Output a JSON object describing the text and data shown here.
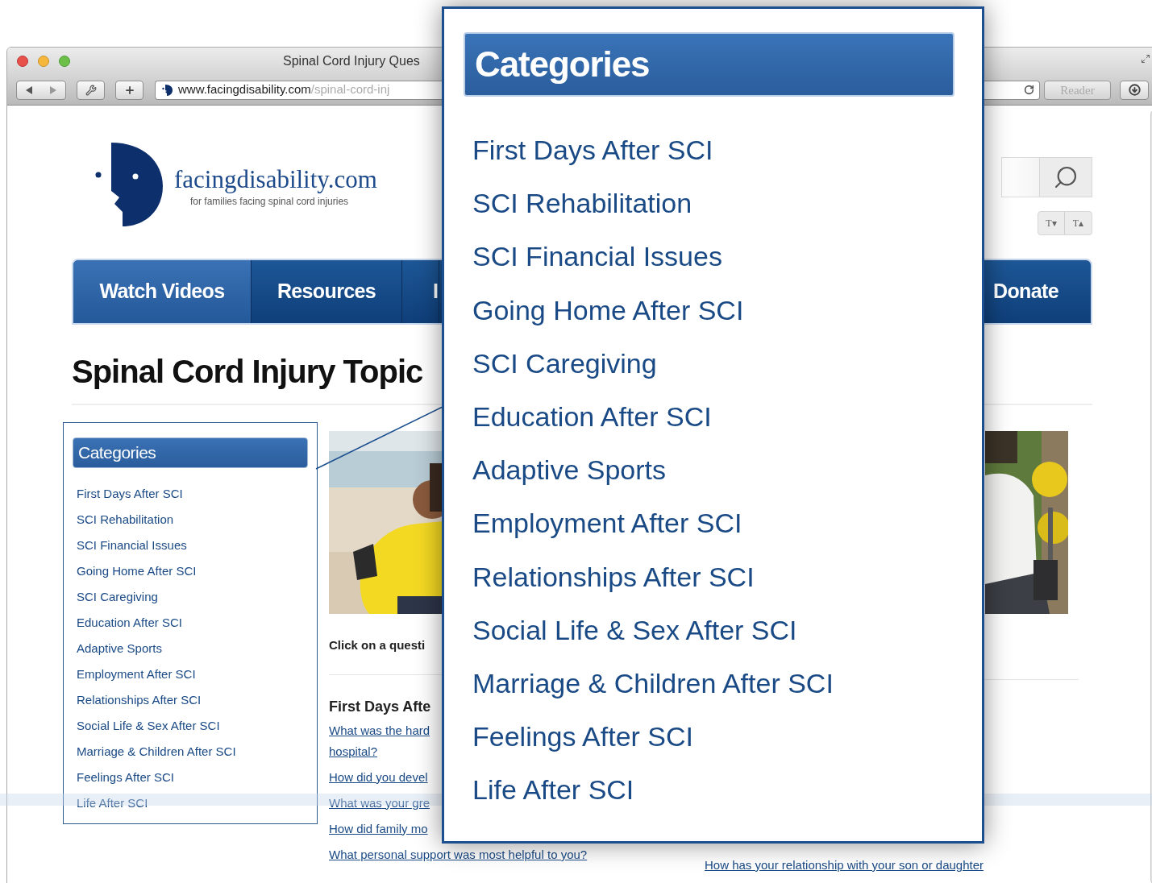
{
  "browser": {
    "title": "Spinal Cord Injury Ques",
    "address_domain": "www.facingdisability.com",
    "address_path": "/spinal-cord-inj",
    "reader_button": "Reader"
  },
  "site": {
    "logo_text": "facingdisability.com",
    "tagline": "for families facing spinal cord injuries",
    "text_size_buttons": [
      "T▾",
      "T▴"
    ]
  },
  "nav": {
    "items": [
      {
        "label": "Watch Videos",
        "selected": true
      },
      {
        "label": "Resources",
        "selected": false
      },
      {
        "label": "I",
        "selected": false
      }
    ],
    "donate": "Donate"
  },
  "heading": "Spinal Cord Injury Topic",
  "sidebar": {
    "title": "Categories",
    "items": [
      "First Days After SCI",
      "SCI Rehabilitation",
      "SCI Financial Issues",
      "Going Home After SCI",
      "SCI Caregiving",
      "Education After SCI",
      "Adaptive Sports",
      "Employment After SCI",
      "Relationships After SCI",
      "Social Life & Sex After SCI",
      "Marriage & Children After SCI",
      "Feelings After SCI",
      "Life After SCI"
    ]
  },
  "intro": "Click on a questi",
  "questions": {
    "title": "First Days Afte",
    "links": [
      "What was the hard",
      "hospital?",
      "How did you devel",
      "What was your gre",
      "How did family mo",
      "What personal support was most helpful to you?"
    ]
  },
  "right_link": "How has your relationship with your son or daughter",
  "callout": {
    "title": "Categories",
    "items": [
      "First Days After SCI",
      "SCI Rehabilitation",
      "SCI Financial Issues",
      "Going Home After SCI",
      "SCI Caregiving",
      "Education After SCI",
      "Adaptive Sports",
      "Employment After SCI",
      "Relationships After SCI",
      "Social Life & Sex After SCI",
      "Marriage & Children After SCI",
      "Feelings After SCI",
      "Life After SCI"
    ]
  }
}
